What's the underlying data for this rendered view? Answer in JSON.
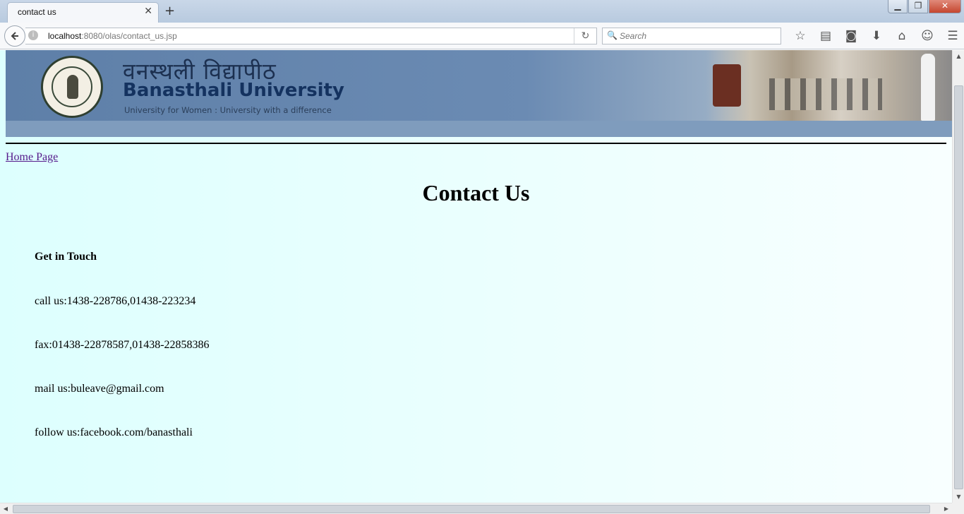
{
  "browser": {
    "tab_title": "contact us",
    "tab_close": "✕",
    "new_tab": "+",
    "window_controls": {
      "minimize": "▁",
      "restore": "❐",
      "close": "✕"
    },
    "url_host": "localhost",
    "url_path": ":8080/olas/contact_us.jsp",
    "search_placeholder": "Search",
    "toolbar_icons": [
      "star-icon",
      "reader-list-icon",
      "pocket-icon",
      "download-icon",
      "home-icon",
      "chat-icon",
      "menu-icon"
    ]
  },
  "banner": {
    "hindi_name": "वनस्थली विद्यापीठ",
    "university_name": "Banasthali University",
    "tagline": "University for Women : University with a difference"
  },
  "page": {
    "home_link": "Home Page",
    "heading": "Contact Us",
    "section_title": "Get in Touch",
    "lines": [
      "call us:1438-228786,01438-223234",
      "fax:01438-22878587,01438-22858386",
      "mail us:buleave@gmail.com",
      "follow us:facebook.com/banasthali"
    ]
  },
  "colors": {
    "page_background": "#e6fffe",
    "banner_blue": "#6b8bb3",
    "visited_link": "#551a8b"
  }
}
